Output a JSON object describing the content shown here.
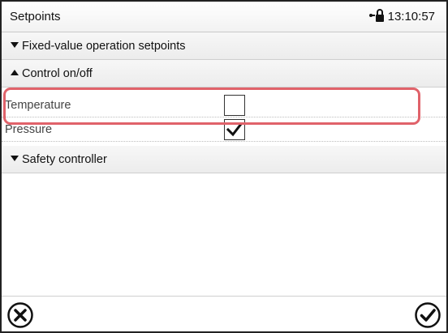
{
  "header": {
    "title": "Setpoints",
    "time": "13:10:57"
  },
  "sections": {
    "fixed_value": {
      "label": "Fixed-value operation setpoints",
      "expanded": false
    },
    "control": {
      "label": "Control on/off",
      "expanded": true
    },
    "safety": {
      "label": "Safety controller",
      "expanded": false
    }
  },
  "control_rows": [
    {
      "label": "Temperature",
      "checked": false,
      "highlighted": true
    },
    {
      "label": "Pressure",
      "checked": true,
      "highlighted": false
    }
  ],
  "icons": {
    "header_status": "lock-icon",
    "footer_left": "cancel-icon",
    "footer_right": "confirm-icon"
  },
  "colors": {
    "highlight": "#e0626a"
  }
}
